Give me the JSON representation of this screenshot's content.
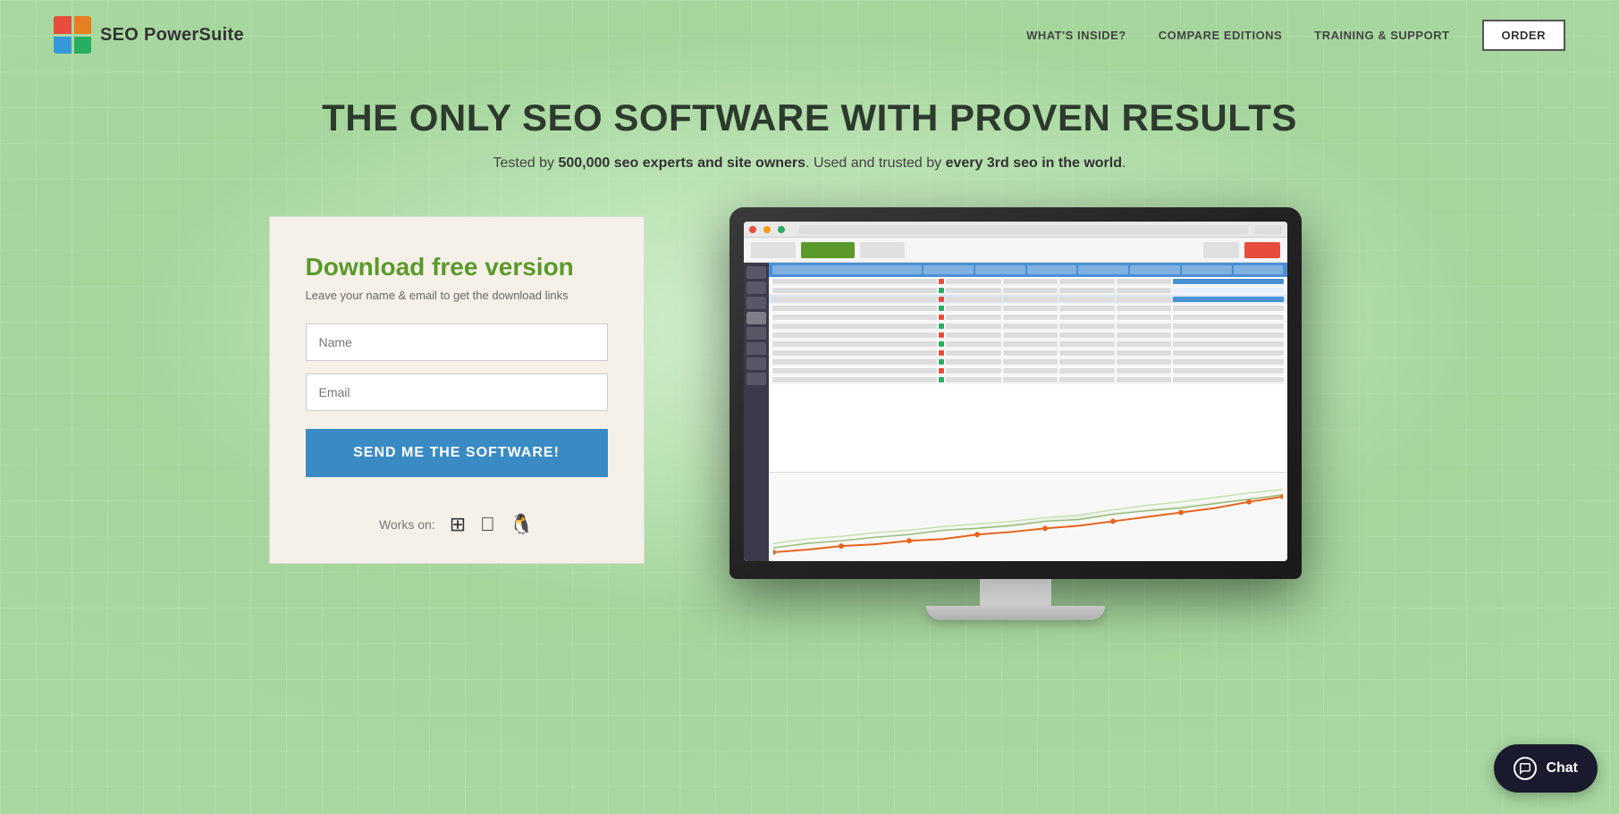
{
  "nav": {
    "logo_text_seo": "SEO ",
    "logo_text_bold": "PowerSuite",
    "link1": "WHAT'S INSIDE?",
    "link2": "COMPARE EDITIONS",
    "link3": "TRAINING & SUPPORT",
    "order_btn": "ORDER"
  },
  "hero": {
    "title": "THE ONLY SEO SOFTWARE WITH PROVEN RESULTS",
    "subtitle_prefix": "Tested by ",
    "subtitle_bold1": "500,000 seo experts and site owners",
    "subtitle_mid": ". Used and trusted by ",
    "subtitle_bold2": "every 3rd seo in the world",
    "subtitle_end": "."
  },
  "form": {
    "title": "Download free version",
    "subtitle": "Leave your name & email to get the download links",
    "name_placeholder": "Name",
    "email_placeholder": "Email",
    "submit_label": "SEND ME THE SOFTWARE!"
  },
  "works_on": {
    "label": "Works on:"
  },
  "chat": {
    "label": "Chat"
  }
}
